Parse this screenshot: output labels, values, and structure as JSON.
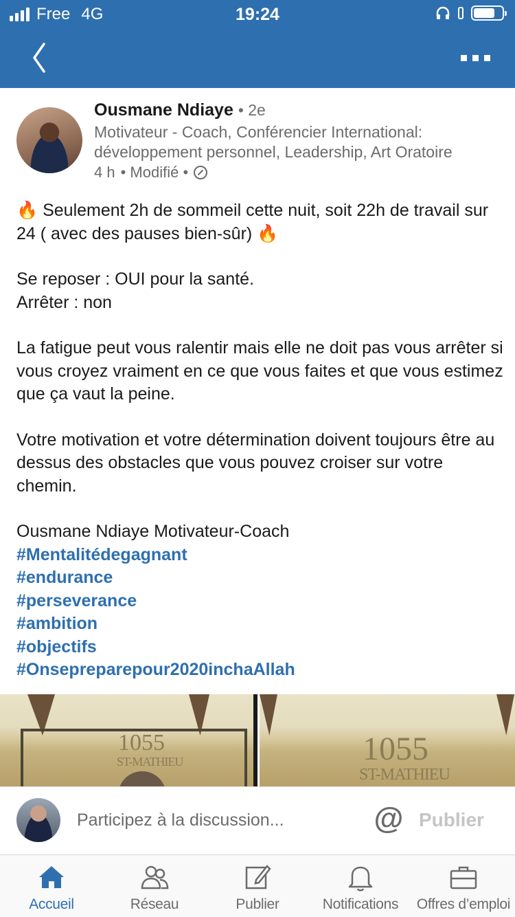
{
  "status_bar": {
    "carrier": "Free",
    "network": "4G",
    "time": "19:24"
  },
  "nav": {
    "back_icon": "chevron-left-icon",
    "more_icon": "more-icon"
  },
  "post": {
    "author": "Ousmane Ndiaye",
    "degree": "• 2e",
    "headline": "Motivateur - Coach, Conférencier International: développement personnel, Leadership, Art Oratoire",
    "time": "4 h",
    "edited": "• Modifié •",
    "body": {
      "line1": "Seulement 2h de sommeil cette nuit, soit 22h de travail sur 24 ( avec des pauses bien-sûr)",
      "fire_emoji": "🔥",
      "p2_line1": "Se reposer : OUI pour la santé.",
      "p2_line2": "Arrêter : non",
      "p3": "La fatigue peut vous ralentir mais elle ne doit pas vous arrêter si vous croyez vraiment en ce que vous faites et que vous estimez que ça vaut la peine.",
      "p4": "Votre  motivation et votre détermination doivent toujours être au dessus des obstacles que vous pouvez croiser sur votre chemin.",
      "signature": "Ousmane Ndiaye Motivateur-Coach"
    },
    "hashtags": [
      "#Mentalitédegagnant",
      "#endurance",
      "#perseverance",
      "#ambition",
      "#objectifs",
      "#Onsepreparepour2020inchaAllah"
    ],
    "image_texts": {
      "number": "1055",
      "street": "ST-MATHIEU"
    }
  },
  "comment_bar": {
    "placeholder": "Participez à la discussion...",
    "at_symbol": "@",
    "publish_label": "Publier"
  },
  "tabs": [
    {
      "label": "Accueil",
      "icon": "home-icon",
      "active": true
    },
    {
      "label": "Réseau",
      "icon": "network-icon",
      "active": false
    },
    {
      "label": "Publier",
      "icon": "compose-icon",
      "active": false
    },
    {
      "label": "Notifications",
      "icon": "bell-icon",
      "active": false
    },
    {
      "label": "Offres d’emploi",
      "icon": "briefcase-icon",
      "active": false
    }
  ],
  "colors": {
    "brand_blue": "#2e6fb0",
    "text": "#1a1a1a",
    "muted": "#6b6b6b",
    "disabled": "#c5c5c5"
  }
}
